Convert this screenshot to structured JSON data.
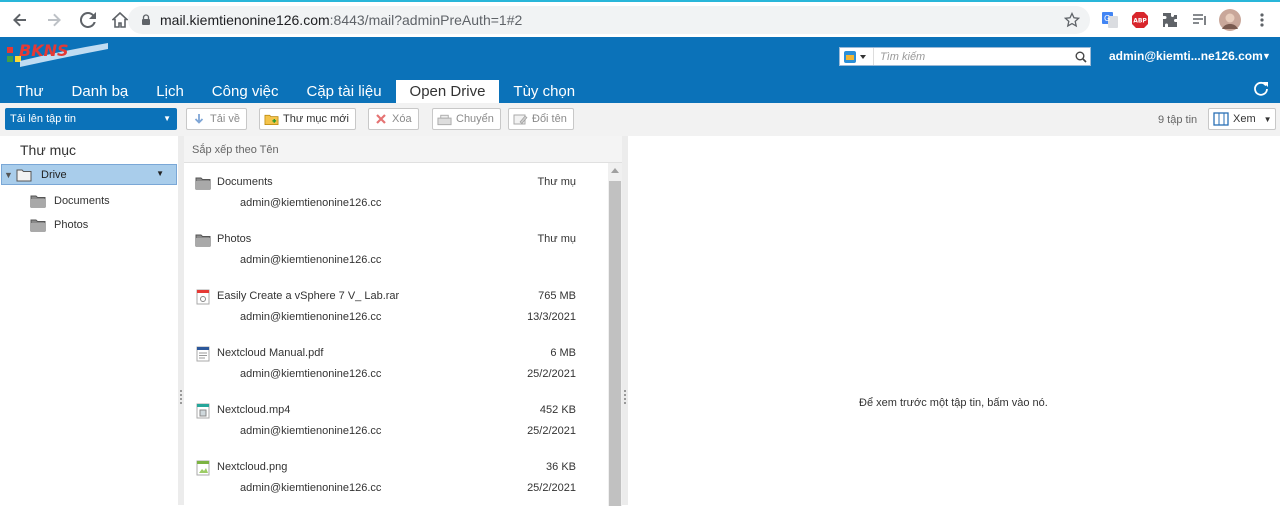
{
  "browser": {
    "url_host": "mail.kiemtienonine126.com",
    "url_rest": ":8443/mail?adminPreAuth=1#2"
  },
  "header": {
    "logo_text": "BKNS",
    "search_placeholder": "Tìm kiếm",
    "user": "admin@kiemti...ne126.com"
  },
  "tabs": [
    {
      "label": "Thư"
    },
    {
      "label": "Danh bạ"
    },
    {
      "label": "Lịch"
    },
    {
      "label": "Công việc"
    },
    {
      "label": "Cặp tài liệu"
    },
    {
      "label": "Open Drive",
      "active": true
    },
    {
      "label": "Tùy chọn"
    }
  ],
  "toolbar": {
    "upload": "Tải lên tập tin",
    "download": "Tải về",
    "new_folder": "Thư mục mới",
    "delete": "Xóa",
    "move": "Chuyển",
    "rename": "Đổi tên",
    "count": "9 tập tin",
    "view": "Xem"
  },
  "left": {
    "heading": "Thư mục",
    "root": "Drive",
    "children": [
      "Documents",
      "Photos"
    ]
  },
  "list": {
    "sort_label": "Sắp xếp theo Tên",
    "files": [
      {
        "name": "Documents",
        "size": "Thư mụ",
        "owner": "admin@kiemtienonine126.cc",
        "date": "",
        "icon": "folder-icon"
      },
      {
        "name": "Photos",
        "size": "Thư mụ",
        "owner": "admin@kiemtienonine126.cc",
        "date": "",
        "icon": "folder-icon"
      },
      {
        "name": "Easily Create a vSphere 7 V_ Lab.rar",
        "size": "765 MB",
        "owner": "admin@kiemtienonine126.cc",
        "date": "13/3/2021",
        "icon": "archive-file-icon"
      },
      {
        "name": "Nextcloud Manual.pdf",
        "size": "6 MB",
        "owner": "admin@kiemtienonine126.cc",
        "date": "25/2/2021",
        "icon": "document-file-icon"
      },
      {
        "name": "Nextcloud.mp4",
        "size": "452 KB",
        "owner": "admin@kiemtienonine126.cc",
        "date": "25/2/2021",
        "icon": "video-file-icon"
      },
      {
        "name": "Nextcloud.png",
        "size": "36 KB",
        "owner": "admin@kiemtienonine126.cc",
        "date": "25/2/2021",
        "icon": "image-file-icon"
      }
    ]
  },
  "preview": {
    "message": "Để xem trước một tập tin, bấm vào nó."
  },
  "colors": {
    "brand": "#0b72b9",
    "selected": "#a9cdeb"
  }
}
